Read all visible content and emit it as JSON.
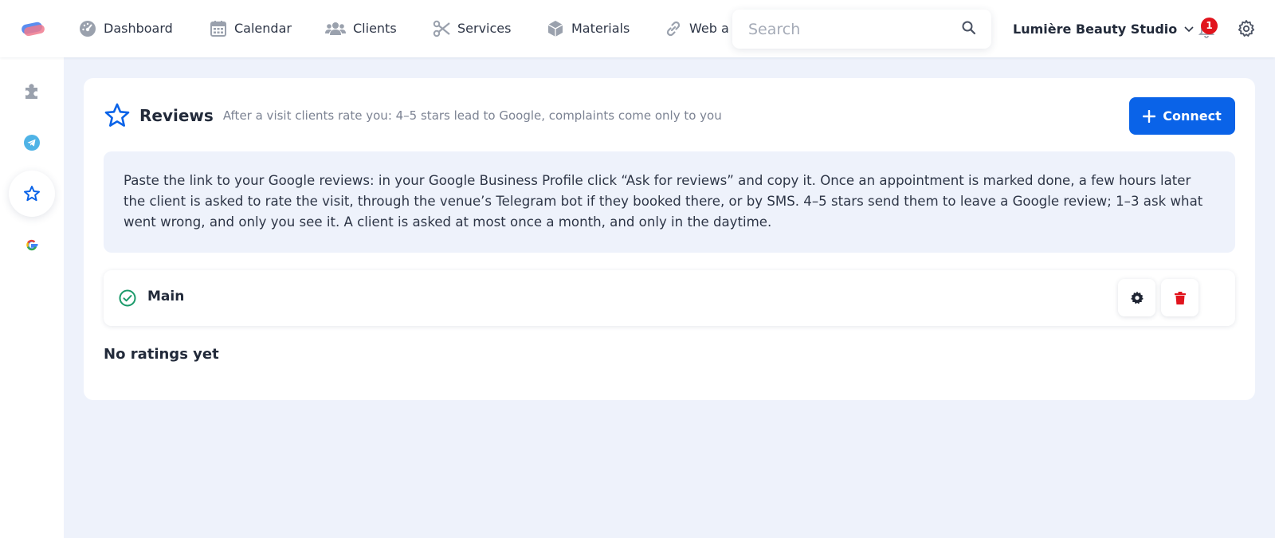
{
  "nav": {
    "items": [
      {
        "label": "Dashboard",
        "icon": "dashboard-icon"
      },
      {
        "label": "Calendar",
        "icon": "calendar-icon"
      },
      {
        "label": "Clients",
        "icon": "users-icon"
      },
      {
        "label": "Services",
        "icon": "scissors-icon"
      },
      {
        "label": "Materials",
        "icon": "box-icon"
      },
      {
        "label": "Web a",
        "icon": "link-icon"
      }
    ]
  },
  "search": {
    "placeholder": "Search"
  },
  "account": {
    "studio_name": "Lumière Beauty Studio"
  },
  "notifications": {
    "count": "1"
  },
  "sidebar": {
    "items": [
      {
        "name": "integrations",
        "icon": "puzzle-icon",
        "active": false
      },
      {
        "name": "telegram",
        "icon": "telegram-icon",
        "active": false
      },
      {
        "name": "reviews",
        "icon": "star-icon",
        "active": true
      },
      {
        "name": "google",
        "icon": "google-icon",
        "active": false
      }
    ]
  },
  "reviews": {
    "title": "Reviews",
    "subtitle": "After a visit clients rate you: 4–5 stars lead to Google, complaints come only to you",
    "connect_label": "Connect",
    "info_text": "Paste the link to your Google reviews: in your Google Business Profile click “Ask for reviews” and copy it. Once an appointment is marked done, a few hours later the client is asked to rate the visit, through the venue’s Telegram bot if they booked there, or by SMS. 4–5 stars send them to leave a Google review; 1–3 ask what went wrong, and only you see it. A client is asked at most once a month, and only in the daytime.",
    "connection": {
      "name": "Main",
      "status": "active"
    },
    "empty_text": "No ratings yet"
  },
  "colors": {
    "accent": "#0a63e8",
    "success": "#1a9a6a",
    "danger": "#e1141d",
    "background": "#eef2fb"
  }
}
